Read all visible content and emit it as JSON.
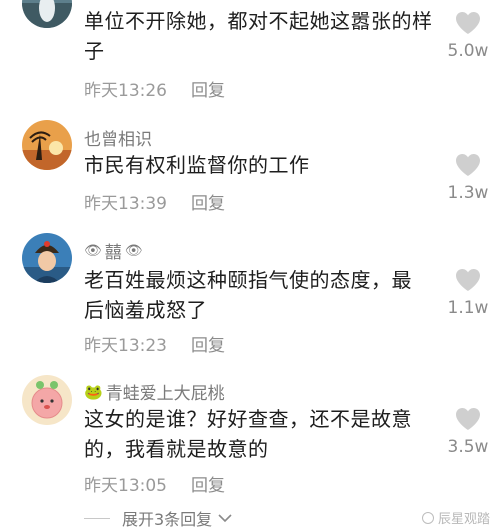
{
  "comments": [
    {
      "username": "",
      "text": "单位不开除她，都对不起她这嚣张的样子",
      "time": "昨天13:26",
      "reply_label": "回复",
      "likes": "5.0w"
    },
    {
      "username": "也曾相识",
      "text": "市民有权利监督你的工作",
      "time": "昨天13:39",
      "reply_label": "回复",
      "likes": "1.3w"
    },
    {
      "username": "囍",
      "username_emoji_left": "👁",
      "username_emoji_right": "👁",
      "text": "老百姓最烦这种颐指气使的态度，最后恼羞成怒了",
      "time": "昨天13:23",
      "reply_label": "回复",
      "likes": "1.1w"
    },
    {
      "username": "青蛙爱上大屁桃",
      "username_emoji_left": "🐸",
      "text": "这女的是谁？好好查查，还不是故意的，我看就是故意的",
      "time": "昨天13:05",
      "reply_label": "回复",
      "likes": "3.5w"
    }
  ],
  "expand_label": "展开3条回复",
  "watermark": "辰星观踏",
  "icons": {
    "like": "heart-icon",
    "expand": "chevron-down-icon"
  },
  "colors": {
    "text": "#1e1e1e",
    "meta": "#9a9a9a",
    "heart": "#cfcfcf"
  }
}
